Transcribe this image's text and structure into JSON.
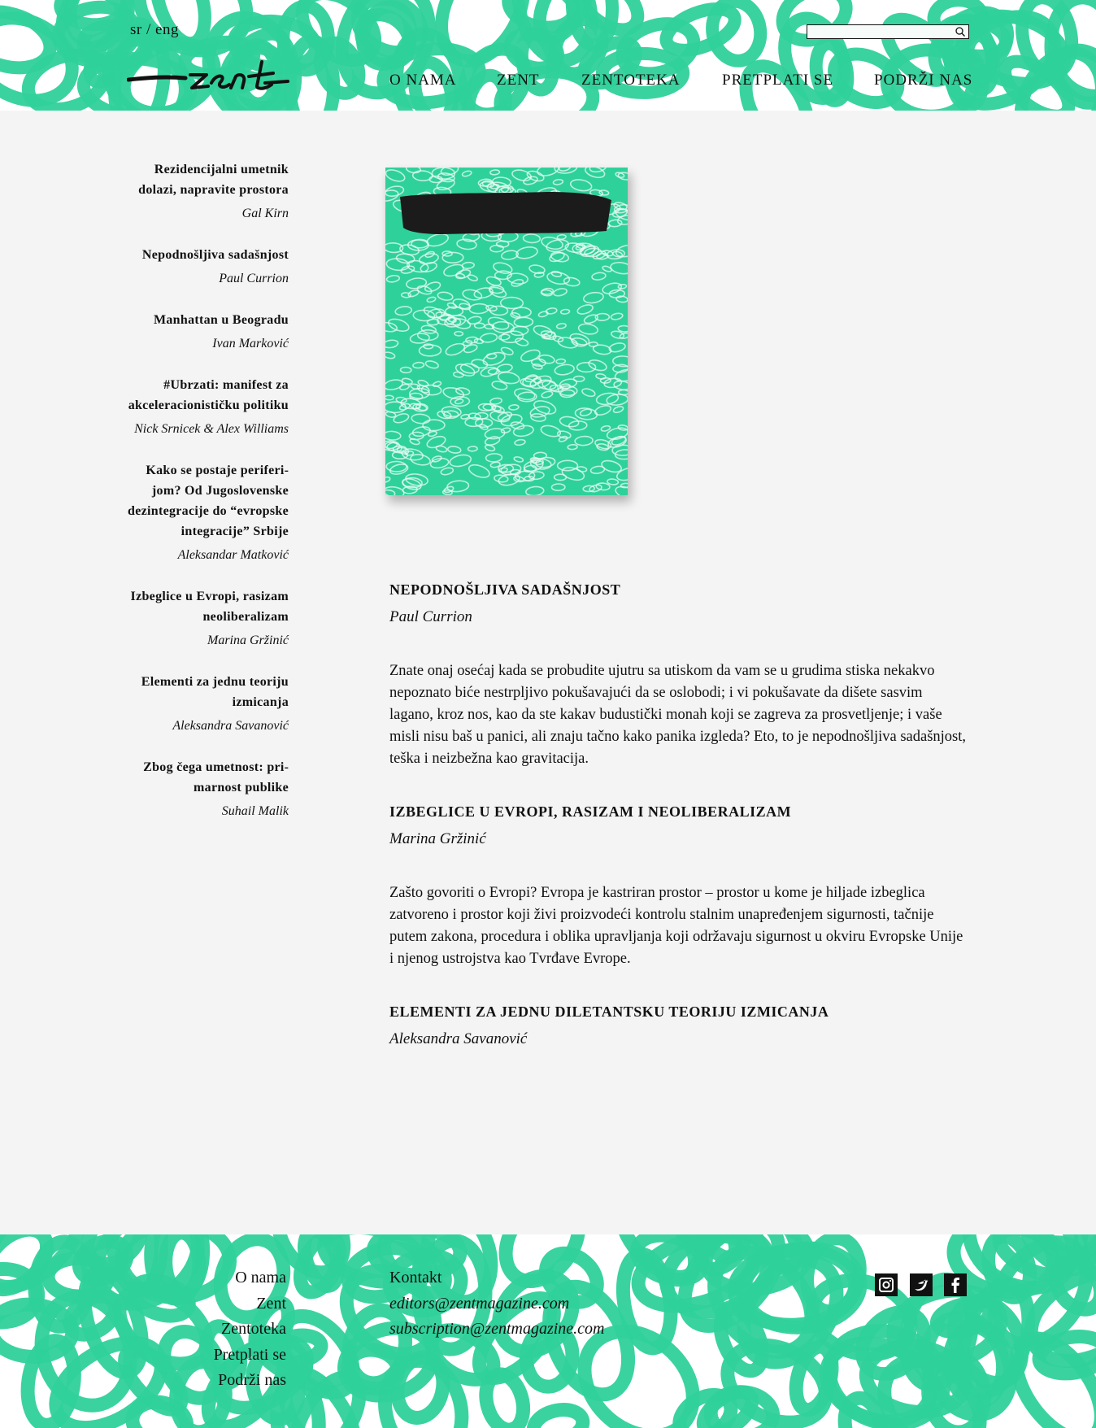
{
  "header": {
    "lang_sr": "sr",
    "lang_sep": "/",
    "lang_eng": "eng",
    "search_value": "",
    "nav": [
      "O NAMA",
      "ZENT",
      "ZENTOTEKA",
      "PRETPLATI SE",
      "PODRŽI NAS"
    ]
  },
  "sidebar": {
    "items": [
      {
        "title": "Rezidencijalni umetnik dolazi, napravite prosto­ra",
        "author": "Gal Kirn"
      },
      {
        "title": "Nepodnošljiva sadašnjost",
        "author": "Paul Currion"
      },
      {
        "title": "Manhattan u Beogradu",
        "author": "Ivan Marković"
      },
      {
        "title": "#Ubrzati: manifest za akceleracionističku poli­tiku",
        "author": "Nick Srnicek & Alex Williams"
      },
      {
        "title": "Kako se postaje periferi­jom? Od Jugoslovenske dezintegracije do “ev­ropske integracije” Srbije",
        "author": "Aleksandar Matković"
      },
      {
        "title": "Izbeglice u Evropi, rasi­zam neoliberalizam",
        "author": "Marina Gržinić"
      },
      {
        "title": "Elementi za jednu teoriju izmicanja",
        "author": "Aleksandra Savanović"
      },
      {
        "title": "Zbog čega umetnost: pri­marnost publike",
        "author": "Suhail Malik"
      }
    ]
  },
  "articles": [
    {
      "title": "NEPODNOŠLJIVA SADAŠNJOST",
      "author": "Paul Currion",
      "excerpt": "Znate onaj osećaj kada se probudite ujutru sa utiskom da vam se u grudima stiska neka­kvo nepoznato biće nestrpljivo pokušavajući da se oslobodi; i vi pokušavate da dišete sasvim lagano, kroz nos, kao da ste kakav budustički monah koji se zagreva za prosvetl­jenje; i vaše misli nisu baš u panici, ali znaju tačno kako panika izgleda? Eto, to je nepodnošljiva sadašnjost, teška i neizbežna kao gravitacija."
    },
    {
      "title": "IZBEGLICE U EVROPI, RASIZAM I NEOLIBERALIZAM",
      "author": "Marina Gržinić",
      "excerpt": "Zašto govoriti o Evropi? Evropa je kastriran prostor – prostor u kome je hiljade izbegli­ca zatvoreno i prostor koji živi proizvodeći kontrolu stalnim unapređenjem sigurnosti, tačnije putem zakona, procedura i oblika upravljanja koji održavaju sigurnost u okviru Evropske Unije i njenog ustrojstva kao Tvrđave Evrope."
    },
    {
      "title": "ELEMENTI ZA JEDNU DILETANTSKU TEORIJU IZMICANJA",
      "author": "Aleksandra Savanović",
      "excerpt": ""
    }
  ],
  "footer": {
    "nav": [
      "O nama",
      "Zent",
      "Zentoteka",
      "Pretplati se",
      "Podrži nas"
    ],
    "contact_label": "Kontakt",
    "emails": [
      "editors@zentmagazine.com",
      "subscription@zentmagazine.com"
    ],
    "social": [
      "instagram-icon",
      "twitter-icon",
      "facebook-icon"
    ]
  },
  "colors": {
    "accent_green": "#2fd19a",
    "background": "#f4f4f4",
    "text": "#111111"
  }
}
